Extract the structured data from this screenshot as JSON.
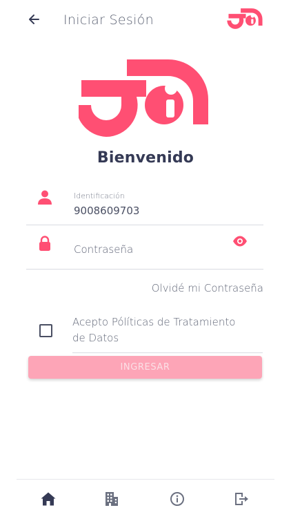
{
  "header": {
    "title": "Iniciar Sesión",
    "back_icon": "arrow-left-icon",
    "logo": "brand-logo"
  },
  "brand": {
    "accent_color": "#ff4f73",
    "dark_color": "#353a55"
  },
  "welcome": "Bienvenido",
  "form": {
    "id_label": "Identificación",
    "id_value": "9008609703",
    "id_icon": "user-icon",
    "password_placeholder": "Contraseña",
    "password_icon": "lock-icon",
    "eye_icon": "eye-icon",
    "forgot_password": "Olvidé mi Contraseña",
    "terms_label": "Acepto Pólíticas de Tratamiento de Datos",
    "terms_checked": false,
    "submit_label": "INGRESAR"
  },
  "bottom_nav": [
    {
      "name": "home",
      "icon": "home-icon"
    },
    {
      "name": "company",
      "icon": "building-icon"
    },
    {
      "name": "info",
      "icon": "info-icon"
    },
    {
      "name": "logout",
      "icon": "logout-icon"
    }
  ]
}
